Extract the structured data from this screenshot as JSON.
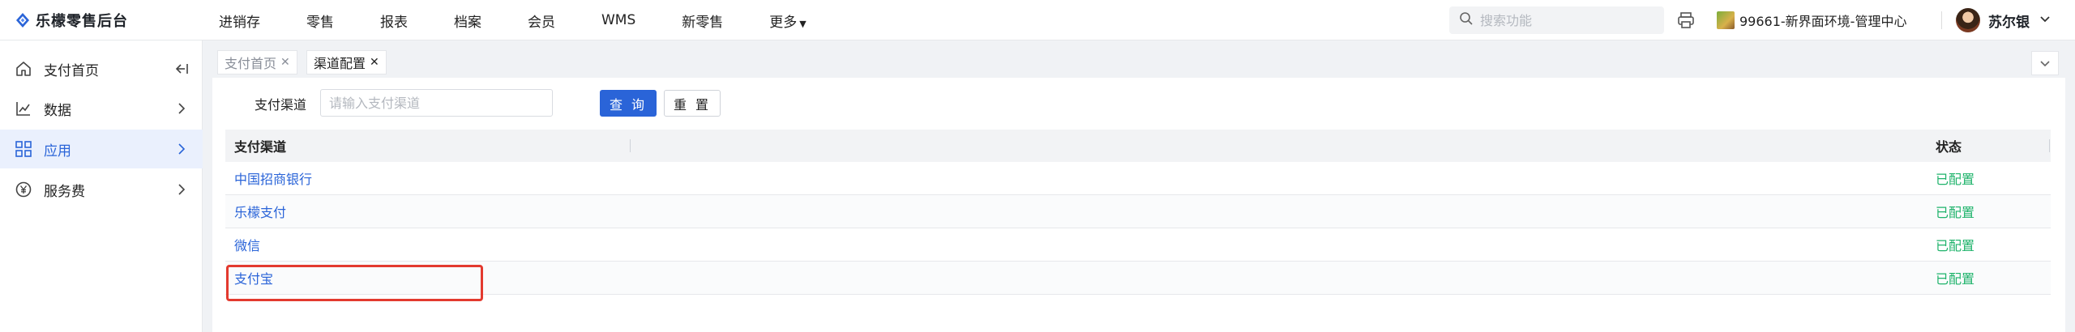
{
  "app": {
    "title": "乐檬零售后台"
  },
  "topnav": {
    "items": [
      {
        "label": "进销存"
      },
      {
        "label": "零售"
      },
      {
        "label": "报表"
      },
      {
        "label": "档案"
      },
      {
        "label": "会员"
      },
      {
        "label": "WMS"
      },
      {
        "label": "新零售"
      },
      {
        "label": "更多"
      }
    ]
  },
  "search": {
    "placeholder": "搜索功能",
    "icon": "search-icon"
  },
  "store": {
    "name": "99661-新界面环境-管理中心"
  },
  "user": {
    "name": "苏尔银"
  },
  "sidebar": {
    "items": [
      {
        "label": "支付首页",
        "icon": "home-icon",
        "active": false
      },
      {
        "label": "数据",
        "icon": "chart-line-icon",
        "active": false
      },
      {
        "label": "应用",
        "icon": "grid-icon",
        "active": true
      },
      {
        "label": "服务费",
        "icon": "yen-icon",
        "active": false
      }
    ]
  },
  "tabs": [
    {
      "label": "支付首页",
      "active": false
    },
    {
      "label": "渠道配置",
      "active": true
    }
  ],
  "filter": {
    "label": "支付渠道",
    "placeholder": "请输入支付渠道",
    "query_label": "查 询",
    "reset_label": "重 置"
  },
  "table": {
    "columns": [
      "支付渠道",
      "状态"
    ],
    "rows": [
      {
        "channel": "中国招商银行",
        "status": "已配置"
      },
      {
        "channel": "乐檬支付",
        "status": "已配置"
      },
      {
        "channel": "微信",
        "status": "已配置"
      },
      {
        "channel": "支付宝",
        "status": "已配置"
      }
    ]
  },
  "colors": {
    "accent": "#2a64d8",
    "status_ok": "#1fb36b",
    "highlight": "#e33a2f"
  }
}
